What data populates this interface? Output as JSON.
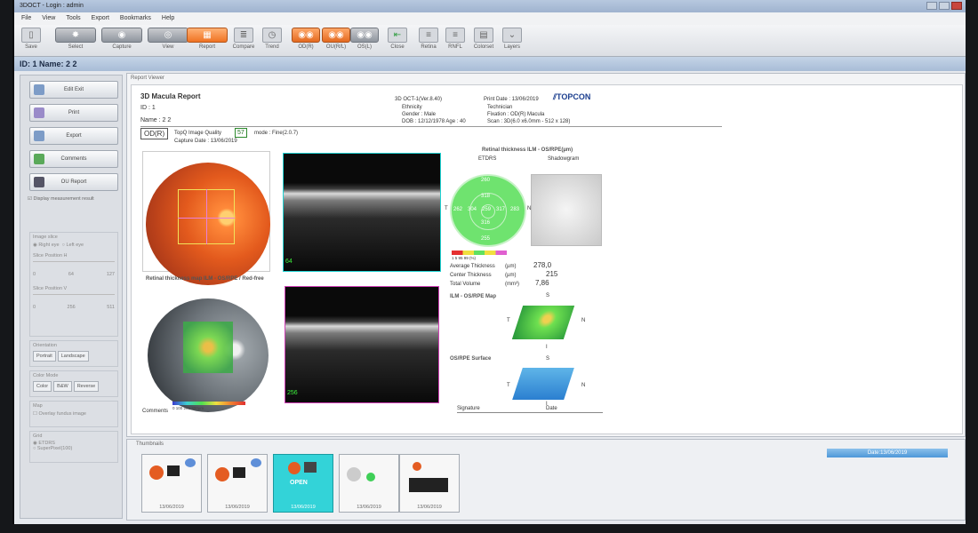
{
  "window": {
    "title": "3DOCT - Login : admin"
  },
  "menu": [
    "File",
    "View",
    "Tools",
    "Export",
    "Bookmarks",
    "Help"
  ],
  "toolbar": {
    "buttons": [
      "Save",
      "Select",
      "Capture",
      "View",
      "Report",
      "Compare",
      "Trend",
      "OD(R)",
      "OU(R/L)",
      "OS(L)",
      "Close",
      "Retina",
      "RNFL",
      "Colorset",
      "Layers"
    ]
  },
  "patient_bar": {
    "text": "ID: 1   Name: 2 2"
  },
  "left_panel": {
    "buttons": [
      "Edit Exit",
      "Print",
      "Export",
      "Comments",
      "OU Report"
    ],
    "display_measurement": "Display measurement result",
    "image_slice": "Image slice",
    "right_eye": "Right eye",
    "left_eye": "Left eye",
    "slice_h": "Slice Position H",
    "slice_h_min": "0",
    "slice_h_val": "64",
    "slice_h_max": "127",
    "slice_v": "Slice Position V",
    "slice_v_min": "0",
    "slice_v_val": "256",
    "slice_v_max": "511",
    "orientation": "Orientation",
    "portrait": "Portrait",
    "landscape": "Landscape",
    "color_mode": "Color Mode",
    "color": "Color",
    "bw": "B&W",
    "reverse": "Reverse",
    "map": "Map",
    "overlay": "Overlay fundus image",
    "grid": "Grid",
    "grid_etdrs": "ETDRS",
    "grid_superpixel": "SuperPixel(100)"
  },
  "report_viewer": {
    "label": "Report Viewer"
  },
  "report": {
    "title": "3D Macula Report",
    "version": "3D OCT-1(Ver.8.40)",
    "print_date": "Print Date : 13/06/2019",
    "brand": "TOPCON",
    "id": "ID : 1",
    "name": "Name : 2 2",
    "ethnicity": "Ethnicity",
    "gender": "Gender : Male",
    "dob": "DOB : 12/12/1978    Age : 40",
    "technician": "Technician",
    "fixation": "Fixation : OD(R) Macula",
    "scan": "Scan : 3D(6.0 x6.0mm - 512 x 128)",
    "eye": "OD(R)",
    "quality_label": "TopQ Image Quality",
    "quality_value": "57",
    "mode": "mode : Fine(2.0.7)",
    "capture_date": "Capture Date : 13/06/2019",
    "retinal_map_title": "Retinal thickness map ILM - OS/RPE / Red-free",
    "comments": "Comments",
    "signature": "Signature",
    "date": "Date",
    "thickness_title": "Retinal thickness ILM - OS/RPE(µm)",
    "etdrs_label": "ETDRS",
    "shadowgram_label": "Shadowgram",
    "etdrs_values": {
      "top": "260",
      "inner_top": "318",
      "left": "262",
      "inner_left": "304",
      "center": "259",
      "inner_right": "317",
      "right": "283",
      "inner_bottom": "316",
      "bottom": "255"
    },
    "etdrs_side_t": "T",
    "etdrs_side_n": "N",
    "scale_ticks": "1    5    95   99    (%)",
    "avg_label": "Average Thickness",
    "avg_unit": "(µm)",
    "avg_value": "278,0",
    "center_label": "Center Thickness",
    "center_unit": "(µm)",
    "center_value": "215",
    "volume_label": "Total Volume",
    "volume_unit": "(mm³)",
    "volume_value": "7,86",
    "map3d_title": "ILM - OS/RPE Map",
    "surface_title": "OS/RPE Surface",
    "s": "S",
    "t": "T",
    "n": "N",
    "i": "I",
    "oct1_label": "64",
    "oct2_label": "256",
    "scale_bottom": "0       100      200      300µm"
  },
  "thumbnails": {
    "label": "Thumbnails",
    "dates": [
      "13/06/2019",
      "13/06/2019",
      "13/06/2019",
      "13/06/2019",
      "13/06/2019"
    ],
    "open_label": "OPEN"
  },
  "status": {
    "date": "Date:13/06/2019"
  }
}
